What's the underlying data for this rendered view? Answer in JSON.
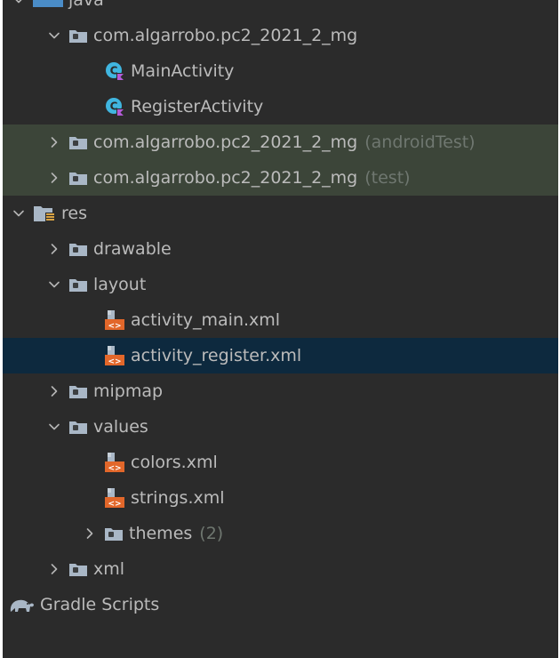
{
  "tree": {
    "java": {
      "label": "java"
    },
    "pkg_main": {
      "label": "com.algarrobo.pc2_2021_2_mg"
    },
    "main_activity": {
      "label": "MainActivity"
    },
    "register_activity": {
      "label": "RegisterActivity"
    },
    "pkg_android_test": {
      "label": "com.algarrobo.pc2_2021_2_mg",
      "suffix": "(androidTest)"
    },
    "pkg_test": {
      "label": "com.algarrobo.pc2_2021_2_mg",
      "suffix": "(test)"
    },
    "res": {
      "label": "res"
    },
    "drawable": {
      "label": "drawable"
    },
    "layout": {
      "label": "layout"
    },
    "activity_main": {
      "label": "activity_main.xml"
    },
    "activity_register": {
      "label": "activity_register.xml"
    },
    "mipmap": {
      "label": "mipmap"
    },
    "values": {
      "label": "values"
    },
    "colors": {
      "label": "colors.xml"
    },
    "strings": {
      "label": "strings.xml"
    },
    "themes": {
      "label": "themes",
      "suffix": "(2)"
    },
    "xml": {
      "label": "xml"
    },
    "gradle": {
      "label": "Gradle Scripts"
    }
  },
  "icons": {
    "folder": "folder-icon",
    "kotlin_class": "kotlin-class-icon",
    "xml_layout": "xml-file-icon",
    "res_folder": "resource-folder-icon",
    "gradle": "gradle-elephant-icon"
  },
  "colors": {
    "background": "#2b2b2b",
    "test_scope_row": "#3c4539",
    "selected_row": "#0d293e",
    "text": "#bbbbbb",
    "muted_text": "#6f7770"
  }
}
